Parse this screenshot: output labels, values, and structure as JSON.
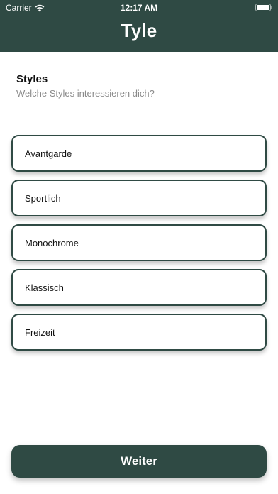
{
  "status_bar": {
    "carrier": "Carrier",
    "time": "12:17 AM",
    "icons": [
      "wifi-icon",
      "battery-icon"
    ]
  },
  "header": {
    "title": "Tyle",
    "background_color": "#2f4a44"
  },
  "section": {
    "title": "Styles",
    "subtitle": "Welche Styles interessieren dich?"
  },
  "options": [
    {
      "label": "Avantgarde"
    },
    {
      "label": "Sportlich"
    },
    {
      "label": "Monochrome"
    },
    {
      "label": "Klassisch"
    },
    {
      "label": "Freizeit"
    }
  ],
  "footer": {
    "next_label": "Weiter"
  },
  "colors": {
    "accent": "#2f4a44",
    "text": "#111111",
    "subtitle": "#8a8a8a"
  }
}
